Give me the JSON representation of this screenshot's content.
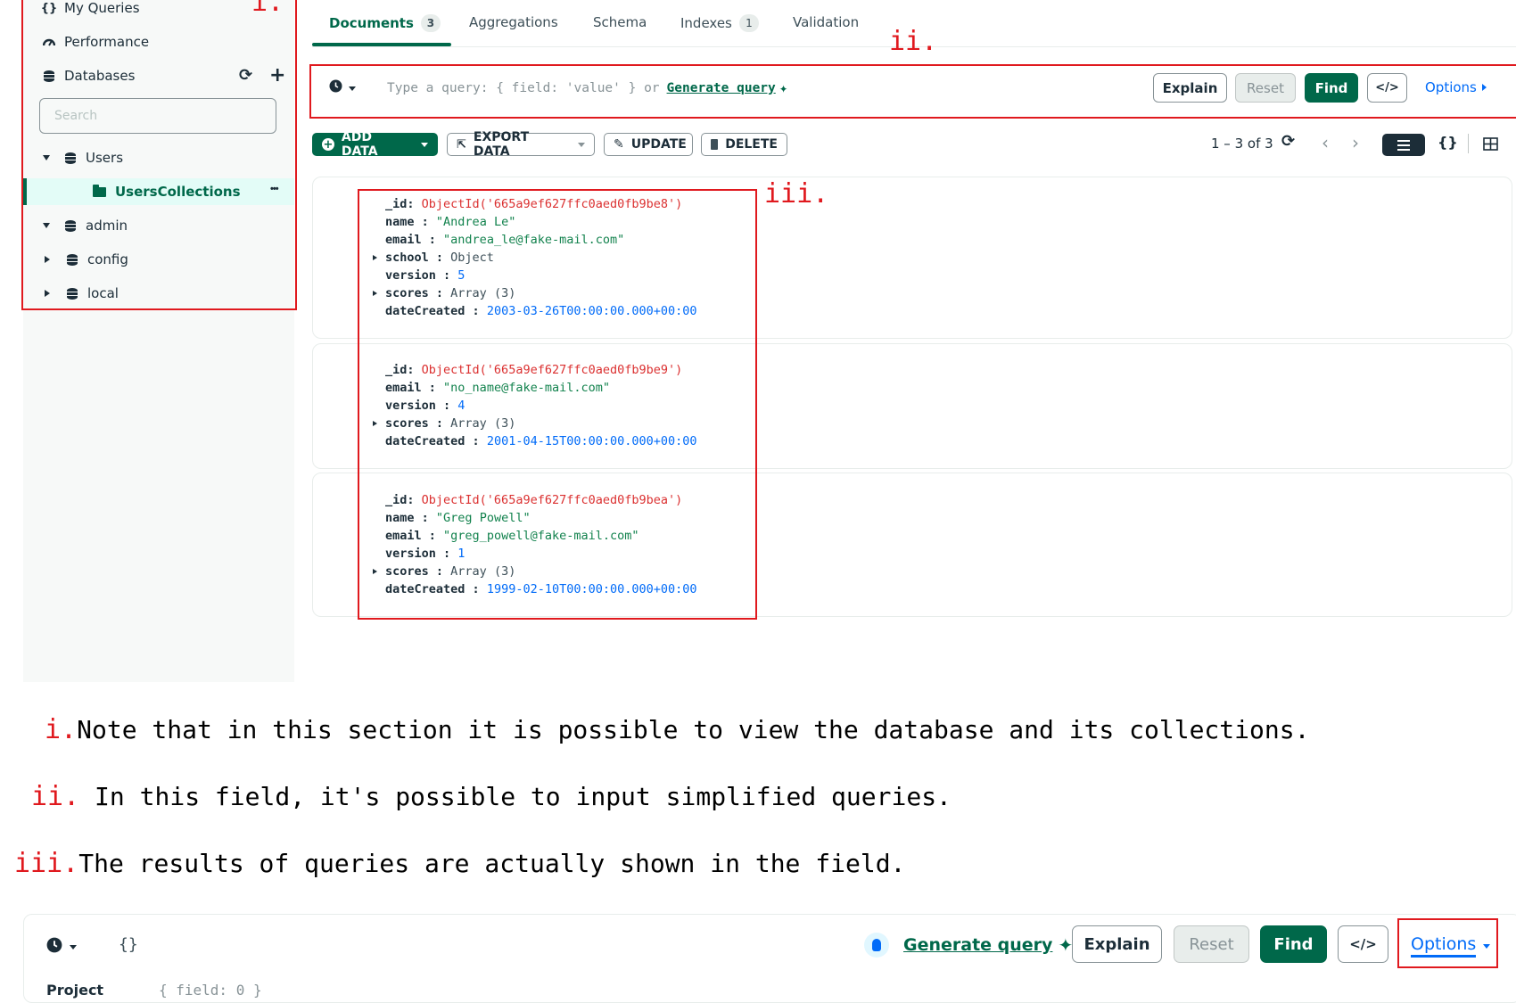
{
  "sidebar": {
    "my_queries": "My Queries",
    "performance": "Performance",
    "databases": "Databases",
    "search_placeholder": "Search",
    "db_users": "Users",
    "collection_selected": "UsersCollections",
    "db_admin": "admin",
    "db_config": "config",
    "db_local": "local",
    "more": "•••"
  },
  "tabs": [
    {
      "label": "Documents",
      "count": "3"
    },
    {
      "label": "Aggregations"
    },
    {
      "label": "Schema"
    },
    {
      "label": "Indexes",
      "count": "1"
    },
    {
      "label": "Validation"
    }
  ],
  "query_bar": {
    "placeholder_text": "Type a query: { field: 'value' } or",
    "generate_query": "Generate query",
    "explain": "Explain",
    "reset": "Reset",
    "find": "Find",
    "code": "</>",
    "options": "Options"
  },
  "toolbar": {
    "add_data": "ADD DATA",
    "export_data": "EXPORT DATA",
    "update": "UPDATE",
    "delete": "DELETE",
    "pagination": "1 – 3 of 3",
    "json_view": "{}"
  },
  "documents": [
    {
      "id": "ObjectId('665a9ef627ffc0aed0fb9be8')",
      "name": "\"Andrea Le\"",
      "email": "\"andrea_le@fake-mail.com\"",
      "school": "Object",
      "version": "5",
      "scores": "Array (3)",
      "dateCreated": "2003-03-26T00:00:00.000+00:00"
    },
    {
      "id": "ObjectId('665a9ef627ffc0aed0fb9be9')",
      "email": "\"no_name@fake-mail.com\"",
      "version": "4",
      "scores": "Array (3)",
      "dateCreated": "2001-04-15T00:00:00.000+00:00"
    },
    {
      "id": "ObjectId('665a9ef627ffc0aed0fb9bea')",
      "name": "\"Greg Powell\"",
      "email": "\"greg_powell@fake-mail.com\"",
      "version": "1",
      "scores": "Array (3)",
      "dateCreated": "1999-02-10T00:00:00.000+00:00"
    }
  ],
  "field_keys": {
    "id": "_id:",
    "name": "name :",
    "email": "email :",
    "school": "school :",
    "version": "version :",
    "scores": "scores :",
    "dateCreated": "dateCreated :"
  },
  "annotations": {
    "i": "i.",
    "ii": "ii.",
    "iii": "iii."
  },
  "notes": [
    {
      "label": "i.",
      "text": "Note that in this section it is possible to view the database and its collections."
    },
    {
      "label": "ii.",
      "text": " In this field, it's possible to input simplified queries."
    },
    {
      "label": "iii.",
      "text": "The results of queries are actually shown in the field."
    }
  ],
  "bottom_bar": {
    "braces": "{}",
    "generate_query": "Generate query",
    "explain": "Explain",
    "reset": "Reset",
    "find": "Find",
    "code": "</>",
    "options": "Options",
    "project_label": "Project",
    "project_placeholder": "{ field: 0 }"
  },
  "colors": {
    "brand_green": "#00684a",
    "annotation_red": "#e0191e",
    "link_blue": "#016bf8"
  }
}
